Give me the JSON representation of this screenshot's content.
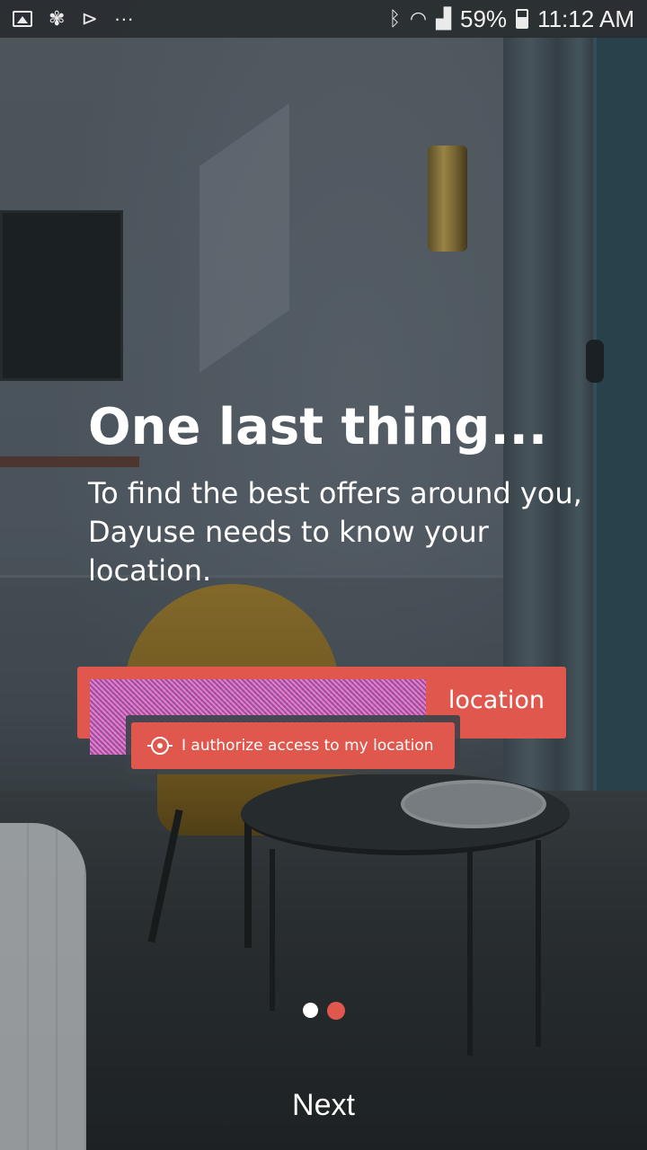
{
  "status_bar": {
    "signal_percent": "59%",
    "time": "11:12 AM",
    "icons_left": [
      "image-icon",
      "pinwheel-icon",
      "send-icon",
      "more-dots-icon"
    ],
    "icons_right": [
      "bluetooth-icon",
      "wifi-icon",
      "signal-icon",
      "battery-icon"
    ]
  },
  "onboarding": {
    "title": "One last thing...",
    "description": "To find the best offers around you, Dayuse needs to know your location."
  },
  "permission": {
    "main_button_label_visible": "location",
    "authorize_button_label": "I authorize access to my location"
  },
  "pager": {
    "current_page": 2,
    "total_pages": 2
  },
  "footer": {
    "next_label": "Next"
  },
  "colors": {
    "accent": "#e0574d",
    "text": "#ffffff"
  }
}
